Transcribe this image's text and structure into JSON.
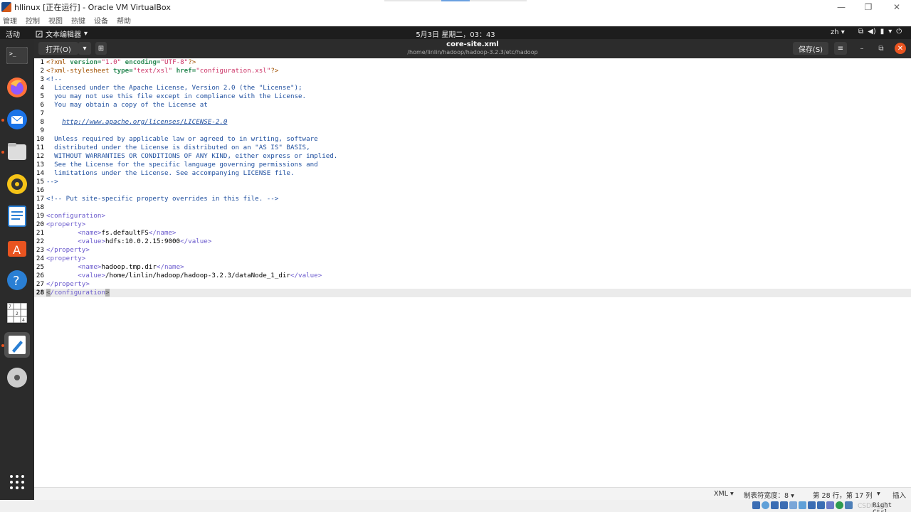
{
  "vbox": {
    "title": "hllinux [正在运行] - Oracle VM VirtualBox",
    "menus": [
      "管理",
      "控制",
      "视图",
      "热键",
      "设备",
      "帮助"
    ],
    "minimize": "—",
    "restore": "❐",
    "close": "✕",
    "host_key": "Right Ctrl",
    "watermark": "CSDN@江"
  },
  "topbar": {
    "activities": "活动",
    "app_menu": "文本编辑器",
    "clock": "5月3日 星期二，03：43",
    "lang": "zh"
  },
  "dock": {
    "items": [
      "terminal-icon",
      "firefox-icon",
      "thunderbird-icon",
      "files-icon",
      "rhythmbox-icon",
      "writer-icon",
      "software-icon",
      "help-icon",
      "sudoku-icon",
      "text-editor-icon",
      "dvd-icon"
    ],
    "apps_grid": "show-applications-icon"
  },
  "editor": {
    "open_label": "打开(O)",
    "save_label": "保存(S)",
    "title": "core-site.xml",
    "path": "/home/linlin/hadoop/hadoop-3.2.3/etc/hadoop",
    "lines": [
      "1",
      "2",
      "3",
      "4",
      "5",
      "6",
      "7",
      "8",
      "9",
      "10",
      "11",
      "12",
      "13",
      "14",
      "15",
      "16",
      "17",
      "18",
      "19",
      "20",
      "21",
      "22",
      "23",
      "24",
      "25",
      "26",
      "27",
      "28"
    ],
    "code": {
      "l1": [
        "<?xml ",
        "version=",
        "\"1.0\"",
        " encoding=",
        "\"UTF-8\"",
        "?>"
      ],
      "l2": [
        "<?xml-stylesheet ",
        "type=",
        "\"text/xsl\"",
        " href=",
        "\"configuration.xsl\"",
        "?>"
      ],
      "l3": "<!--",
      "l4": "  Licensed under the Apache License, Version 2.0 (the \"License\");",
      "l5": "  you may not use this file except in compliance with the License.",
      "l6": "  You may obtain a copy of the License at",
      "l7": "",
      "l8_indent": "    ",
      "l8_link": "http://www.apache.org/licenses/LICENSE-2.0",
      "l9": "",
      "l10": "  Unless required by applicable law or agreed to in writing, software",
      "l11": "  distributed under the License is distributed on an \"AS IS\" BASIS,",
      "l12": "  WITHOUT WARRANTIES OR CONDITIONS OF ANY KIND, either express or implied.",
      "l13": "  See the License for the specific language governing permissions and",
      "l14": "  limitations under the License. See accompanying LICENSE file.",
      "l15": "-->",
      "l16": "",
      "l17": "<!-- Put site-specific property overrides in this file. -->",
      "l18": "",
      "l19": "<configuration>",
      "l20": "<property>",
      "l21_open": "        <name>",
      "l21_val": "fs.defaultFS",
      "l21_close": "</name>",
      "l22_open": "        <value>",
      "l22_val": "hdfs:10.0.2.15:9000",
      "l22_close": "</value>",
      "l23": "</property>",
      "l24": "<property>",
      "l25_open": "        <name>",
      "l25_val": "hadoop.tmp.dir",
      "l25_close": "</name>",
      "l26_open": "        <value>",
      "l26_val": "/home/linlin/hadoop/hadoop-3.2.3/dataNode_1_dir",
      "l26_close": "</value>",
      "l27": "</property>",
      "l28_a": "<",
      "l28_b": "/configuration",
      "l28_c": ">"
    }
  },
  "status": {
    "language": "XML ▾",
    "tab_width": "制表符宽度：8 ▾",
    "position": "第 28 行，第 17 列",
    "position_arrow": "▾",
    "insert": "插入"
  },
  "colors": {
    "accent": "#e95420",
    "dock_bg": "#2b2b2b",
    "topbar_bg": "#1d1d1d"
  }
}
